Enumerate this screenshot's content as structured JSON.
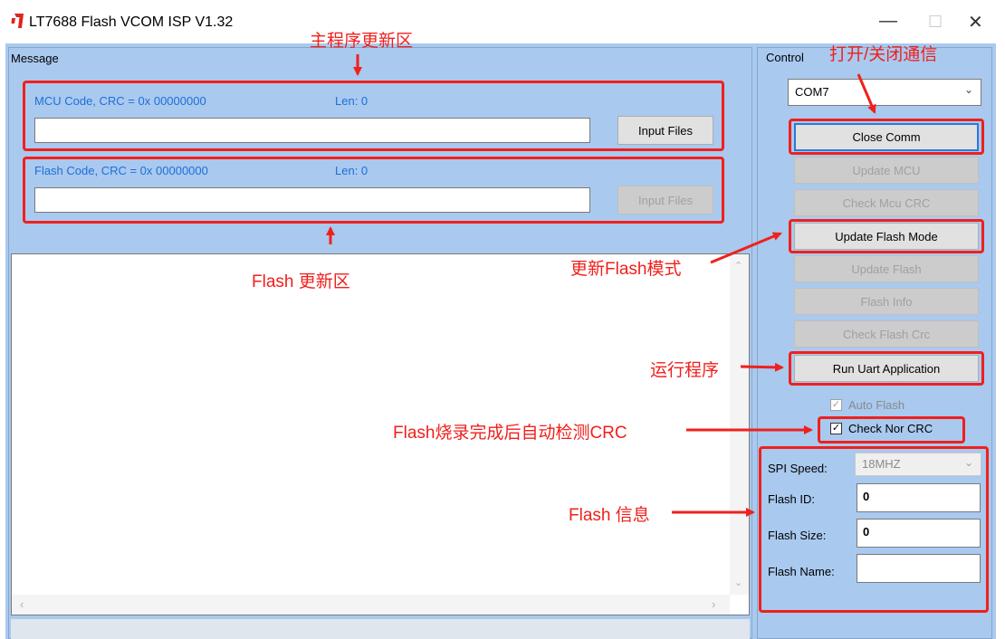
{
  "window": {
    "title": "LT7688 Flash VCOM ISP V1.32",
    "minimize_glyph": "—",
    "maximize_glyph": "☐",
    "close_glyph": "✕"
  },
  "message": {
    "group_label": "Message",
    "mcu_code_label": "MCU Code, CRC = 0x 00000000",
    "mcu_len_label": "Len:  0",
    "mcu_path_value": "",
    "mcu_input_button": "Input Files",
    "flash_code_label": "Flash Code, CRC = 0x 00000000",
    "flash_len_label": "Len:  0",
    "flash_path_value": "",
    "flash_input_button": "Input Files",
    "log_text": ""
  },
  "control": {
    "group_label": "Control",
    "com_port": "COM7",
    "buttons": {
      "close_comm": "Close Comm",
      "update_mcu": "Update MCU",
      "check_mcu_crc": "Check Mcu CRC",
      "update_flash_mode": "Update Flash Mode",
      "update_flash": "Update Flash",
      "flash_info": "Flash Info",
      "check_flash_crc": "Check Flash Crc",
      "run_uart_application": "Run Uart Application"
    },
    "auto_flash_label": "Auto Flash",
    "check_nor_crc_label": "Check Nor CRC",
    "spi_speed_label": "SPI Speed:",
    "spi_speed_value": "18MHZ",
    "flash_id_label": "Flash ID:",
    "flash_id_value": "0",
    "flash_size_label": "Flash Size:",
    "flash_size_value": "0",
    "flash_name_label": "Flash Name:",
    "flash_name_value": ""
  },
  "annotations": {
    "main_program_area": "主程序更新区",
    "flash_update_area": "Flash 更新区",
    "open_close_comm": "打开/关闭通信",
    "update_flash_mode": "更新Flash模式",
    "run_program": "运行程序",
    "auto_crc_check": "Flash烧录完成后自动检测CRC",
    "flash_info": "Flash 信息"
  },
  "colors": {
    "annotation_red": "#f0201c",
    "panel_blue": "#a9c9ef",
    "label_blue": "#1e6fd9"
  }
}
